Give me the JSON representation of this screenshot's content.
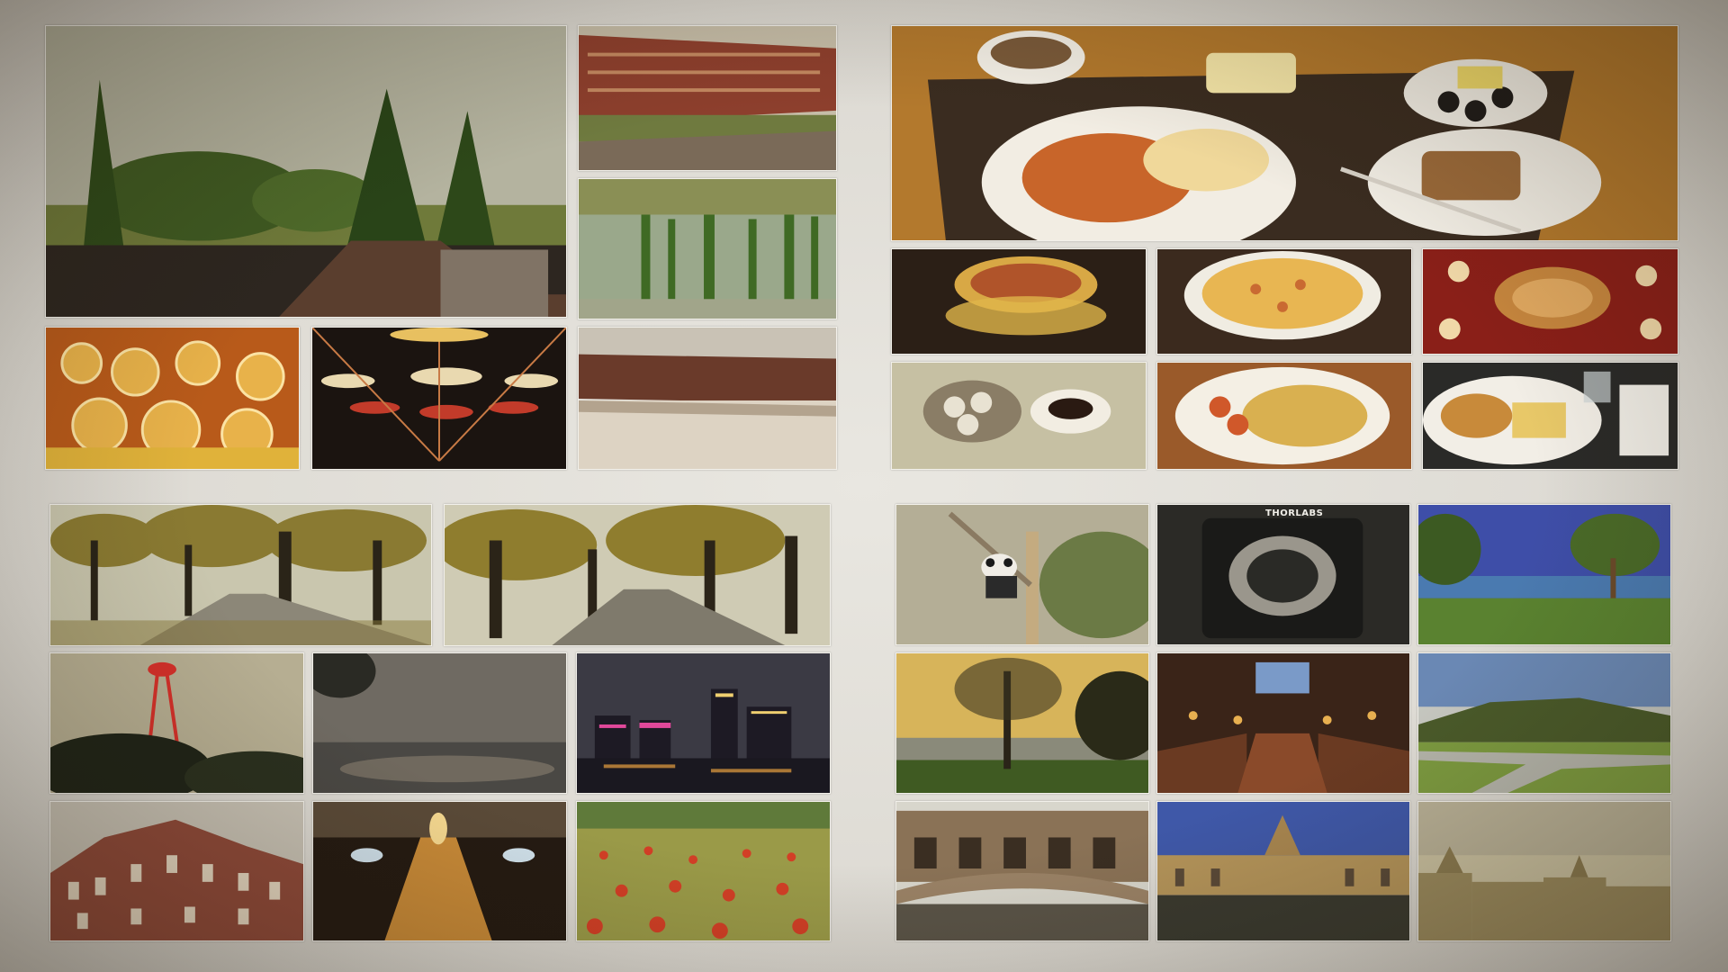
{
  "collage": {
    "panels": [
      {
        "name": "campus-panel",
        "tiles": [
          "pine-trees-rooftop",
          "brick-dormitory",
          "pond-reflection",
          "dumpling-feast",
          "umbrella-ceiling",
          "courtyard-building"
        ]
      },
      {
        "name": "food-panel",
        "tiles": [
          "breakfast-tray",
          "soup-bowl",
          "pizza",
          "hotpot",
          "dim-sum",
          "noodles",
          "fish-and-chips"
        ]
      },
      {
        "name": "autumn-city-panel",
        "tiles": [
          "avenue-left",
          "avenue-right",
          "radio-tower",
          "dusk-lake",
          "harbour-night",
          "victorian-building",
          "tunnel-lights",
          "flower-field"
        ]
      },
      {
        "name": "travel-panel",
        "tiles": [
          "panda-tree",
          "optics-mount",
          "seaside-tree",
          "sunset-campus",
          "dining-hall",
          "hill-path",
          "bridge-of-sighs",
          "college-quad",
          "rooftop-view"
        ]
      }
    ],
    "equipment_label": "THORLABS",
    "colors": {
      "frame": "#f2f0ea",
      "background": "#dcd9d2",
      "sepia": "#c29a55",
      "night": "#1d1a24"
    }
  }
}
